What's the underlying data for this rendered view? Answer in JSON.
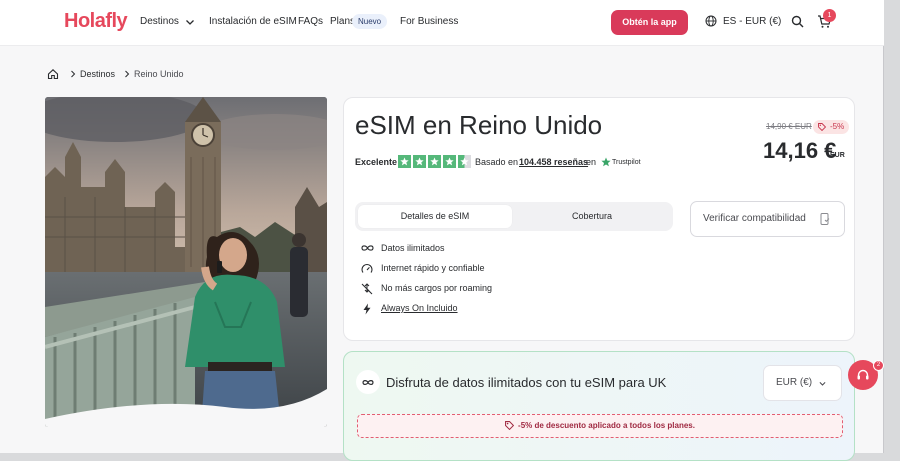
{
  "header": {
    "logo": "Holafly",
    "nav": {
      "destinos": "Destinos",
      "instalacion": "Instalación de eSIM",
      "faqs": "FAQs",
      "plans": "Plans",
      "plans_badge": "Nuevo",
      "business": "For Business"
    },
    "app_button": "Obtén la app",
    "language": "ES - EUR (€)",
    "cart_count": "1"
  },
  "breadcrumb": {
    "items": [
      "Destinos",
      "Reino Unido"
    ]
  },
  "product": {
    "title": "eSIM en Reino Unido",
    "old_price": "14,90 € EUR",
    "discount": "-5%",
    "price": "14,16 €",
    "price_currency": "EUR",
    "rating": {
      "label": "Excelente",
      "stars": 4.5,
      "based_on": "Basado en",
      "count": "104.458 reseñas",
      "on": "en",
      "provider": "Trustpilot"
    },
    "tabs": [
      {
        "label": "Detalles de eSIM",
        "active": true
      },
      {
        "label": "Cobertura",
        "active": false
      }
    ],
    "compat_button": "Verificar compatibilidad",
    "features": [
      {
        "icon": "infinity-icon",
        "label": "Datos ilimitados"
      },
      {
        "icon": "speedometer-icon",
        "label": "Internet rápido y confiable"
      },
      {
        "icon": "no-roaming-icon",
        "label": "No más cargos por roaming"
      },
      {
        "icon": "bolt-icon",
        "label": "Always On Incluido"
      }
    ]
  },
  "promo": {
    "title": "Disfruta de datos ilimitados con tu eSIM para UK",
    "currency_select": "EUR (€)",
    "discount_banner": "-5% de descuento aplicado a todos los planes."
  },
  "chat": {
    "badge": "2"
  },
  "colors": {
    "brand": "#e6485c",
    "button": "#d93a5a",
    "trustpilot": "#55b87a"
  }
}
